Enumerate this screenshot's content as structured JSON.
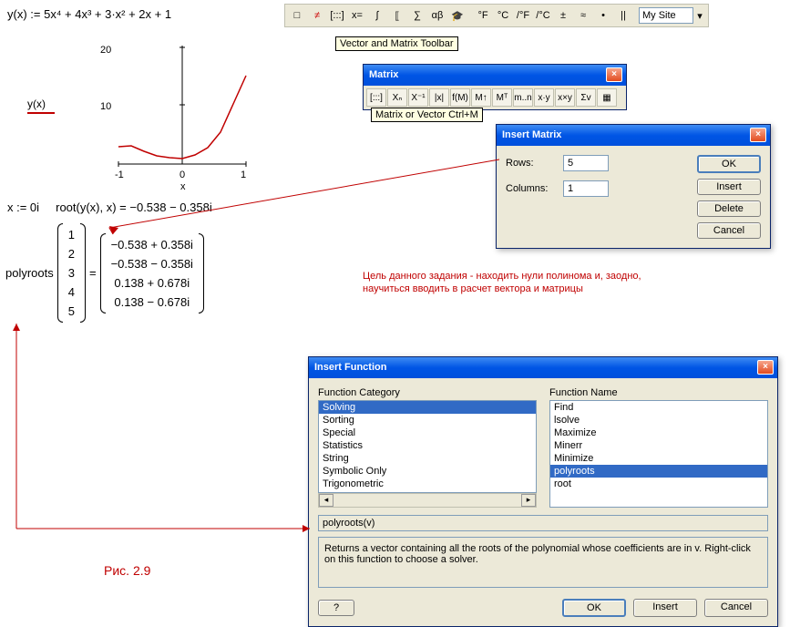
{
  "formula_def": "y(x) := 5x⁴ + 4x³ + 3·x² + 2x + 1",
  "legend_label": "y(x)",
  "chart_data": {
    "type": "line",
    "title": "",
    "xlabel": "x",
    "ylabel": "",
    "xlim": [
      -1,
      1
    ],
    "ylim": [
      0,
      20
    ],
    "xticks": [
      -1,
      0,
      1
    ],
    "yticks": [
      10,
      20
    ],
    "series": [
      {
        "name": "y(x)",
        "color": "#c00000",
        "x": [
          -1,
          -0.8,
          -0.6,
          -0.4,
          -0.2,
          0,
          0.2,
          0.4,
          0.6,
          0.8,
          1
        ],
        "y": [
          3,
          3.0736,
          2.1616,
          1.4416,
          1.0576,
          1,
          1.5536,
          2.8496,
          5.4256,
          10.1776,
          15
        ]
      }
    ]
  },
  "x_init": "x := 0i",
  "root_call": "root(y(x), x) = −0.538 − 0.358i",
  "polyroots_label": "polyroots",
  "input_vector": [
    "1",
    "2",
    "3",
    "4",
    "5"
  ],
  "result_vector": [
    "−0.538 + 0.358i",
    "−0.538 − 0.358i",
    "0.138 + 0.678i",
    "0.138 − 0.678i"
  ],
  "eq": "=",
  "annotation_text": "Цель данного задания - находить нули полинома и, заодно, научиться вводить в расчет вектора и матрицы",
  "fig_label": "Рис. 2.9",
  "toolbar": {
    "items": [
      "□",
      "≠",
      "[:::]",
      "x=",
      "∫",
      "⟦",
      "∑",
      "αβ",
      "🎓"
    ],
    "units": [
      "°F",
      "°C",
      "/°F",
      "/°C",
      "±",
      "≈",
      "•",
      "||"
    ],
    "site_input": "My Site"
  },
  "tooltip1": "Vector and Matrix Toolbar",
  "tooltip2": "Matrix or Vector Ctrl+M",
  "matrix_toolbar": {
    "title": "Matrix",
    "buttons": [
      "[:::]",
      "Xₙ",
      "X⁻¹",
      "|x|",
      "f(M)",
      "M↑",
      "Mᵀ",
      "m..n",
      "x·y",
      "x×y",
      "Σv",
      "▦"
    ]
  },
  "insert_matrix": {
    "title": "Insert Matrix",
    "rows_label": "Rows:",
    "rows_value": "5",
    "cols_label": "Columns:",
    "cols_value": "1",
    "ok": "OK",
    "insert": "Insert",
    "delete": "Delete",
    "cancel": "Cancel"
  },
  "insert_function": {
    "title": "Insert Function",
    "cat_label": "Function Category",
    "name_label": "Function Name",
    "categories": [
      "Solving",
      "Sorting",
      "Special",
      "Statistics",
      "String",
      "Symbolic Only",
      "Trigonometric"
    ],
    "cat_selected": "Solving",
    "functions": [
      "Find",
      "lsolve",
      "Maximize",
      "Minerr",
      "Minimize",
      "polyroots",
      "root"
    ],
    "fn_selected": "polyroots",
    "signature": "polyroots(v)",
    "description": "Returns a vector containing all the roots of the polynomial whose coefficients are in v. Right-click on this function to choose a solver.",
    "help": "?",
    "ok": "OK",
    "insert": "Insert",
    "cancel": "Cancel"
  }
}
